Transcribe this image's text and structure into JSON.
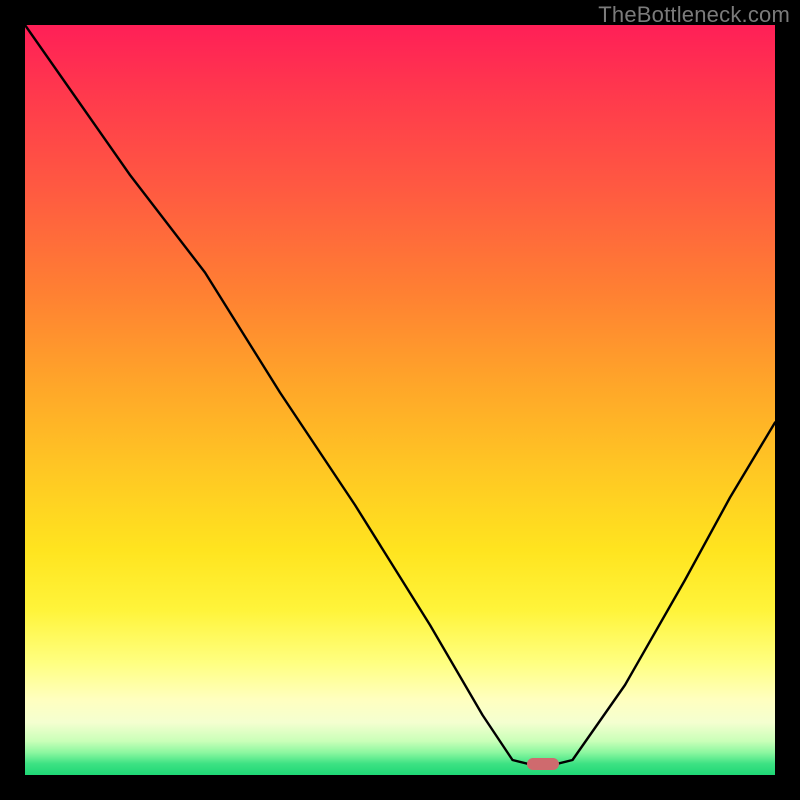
{
  "watermark": "TheBottleneck.com",
  "marker": {
    "x_frac": 0.69,
    "y_frac": 0.985,
    "color": "#cf6a6e"
  },
  "chart_data": {
    "type": "line",
    "title": "",
    "xlabel": "",
    "ylabel": "",
    "xlim": [
      0,
      1
    ],
    "ylim": [
      0,
      1
    ],
    "note": "Axes are unlabeled; values are fractional coordinates (0=left/bottom, 1=right/top) read from the plot area.",
    "series": [
      {
        "name": "curve",
        "x": [
          0.0,
          0.07,
          0.14,
          0.24,
          0.34,
          0.44,
          0.54,
          0.61,
          0.65,
          0.69,
          0.73,
          0.8,
          0.88,
          0.94,
          1.0
        ],
        "y": [
          1.0,
          0.9,
          0.8,
          0.67,
          0.51,
          0.36,
          0.2,
          0.08,
          0.02,
          0.01,
          0.02,
          0.12,
          0.26,
          0.37,
          0.47
        ]
      }
    ],
    "marker_point": {
      "x": 0.69,
      "y": 0.015
    },
    "background_gradient": {
      "top_color": "#ff1f57",
      "mid_color": "#ffe41f",
      "bottom_color": "#1ed775"
    }
  }
}
